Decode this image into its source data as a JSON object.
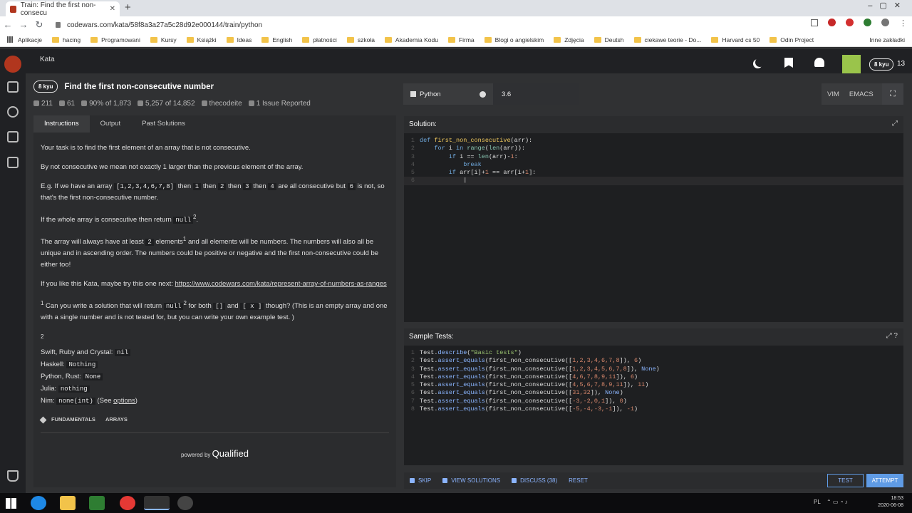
{
  "browser": {
    "tab_title": "Train: Find the first non-consecu",
    "url": "codewars.com/kata/58f8a3a27a5c28d92e000144/train/python",
    "bookmarks": [
      "Aplikacje",
      "hacing",
      "Programowani",
      "Kursy",
      "Książki",
      "Ideas",
      "English",
      "płatności",
      "szkoła",
      "Akademia Kodu",
      "Firma",
      "Blogi o angielskim",
      "Zdjęcia",
      "Deutsh",
      "ciekawe teorie - Do...",
      "Harvard cs 50",
      "Odin Project"
    ],
    "other_bookmarks": "Inne zakładki"
  },
  "header": {
    "kata_label": "Kata",
    "rank": "8 kyu",
    "honor": "13"
  },
  "kata": {
    "rank": "8 kyu",
    "title": "Find the first non-consecutive number",
    "stars": "211",
    "votes": "61",
    "satisfaction": "90% of 1,873",
    "completed": "5,257 of 14,852",
    "author": "thecodeite",
    "issues": "1 Issue Reported"
  },
  "tabs": [
    "Instructions",
    "Output",
    "Past Solutions"
  ],
  "desc": {
    "p1": "Your task is to find the first element of an array that is not consecutive.",
    "p2": "By not consecutive we mean not exactly 1 larger than the previous element of the array.",
    "p3a": "E.g. If we have an array ",
    "p3code1": "[1,2,3,4,6,7,8]",
    "p3b": " then ",
    "p3code2": "1",
    "p3c": " then ",
    "p3code3": "2",
    "p3d": " then ",
    "p3code4": "3",
    "p3e": " then ",
    "p3code5": "4",
    "p3f": " are all consecutive but ",
    "p3code6": "6",
    "p3g": " is not, so that's the first non-consecutive number.",
    "p4a": "If the whole array is consecutive then return ",
    "p4code": "null",
    "p4sup": "2",
    "p4b": ".",
    "p5a": "The array will always have at least ",
    "p5code": "2",
    "p5b": " elements",
    "p5sup": "1",
    "p5c": " and all elements will be numbers. The numbers will also all be unique and in ascending order. The numbers could be positive or negative and the first non-consecutive could be either too!",
    "p6a": "If you like this Kata, maybe try this one next: ",
    "p6link": "https://www.codewars.com/kata/represent-array-of-numbers-as-ranges",
    "p7sup": "1",
    "p7a": " Can you write a solution that will return ",
    "p7code1": "null",
    "p7sup2": "2",
    "p7b": " for both ",
    "p7code2": "[]",
    "p7c": " and ",
    "p7code3": "[ x ]",
    "p7d": " though? (This is an empty array and one with a single number and is not tested for, but you can write your own example test. )",
    "fn2": "2",
    "l1a": "Swift, Ruby and Crystal: ",
    "l1c": "nil",
    "l2a": "Haskell: ",
    "l2c": "Nothing",
    "l3a": "Python, Rust: ",
    "l3c": "None",
    "l4a": "Julia: ",
    "l4c": "nothing",
    "l5a": "Nim: ",
    "l5c": "none(int)",
    "l5b": " (See ",
    "l5link": "options",
    "l5d": ")"
  },
  "tags": [
    "FUNDAMENTALS",
    "ARRAYS"
  ],
  "powered": {
    "prefix": "powered by",
    "brand": "Qualified"
  },
  "editor": {
    "language": "Python",
    "version": "3.6",
    "modes": [
      "VIM",
      "EMACS"
    ],
    "solution_label": "Solution:",
    "tests_label": "Sample Tests:"
  },
  "solution_lines": [
    "1",
    "2",
    "3",
    "4",
    "5",
    "6"
  ],
  "test_lines": [
    "1",
    "2",
    "3",
    "4",
    "5",
    "6",
    "7",
    "8"
  ],
  "actions": {
    "skip": "SKIP",
    "view": "VIEW SOLUTIONS",
    "discuss": "DISCUSS (38)",
    "reset": "RESET",
    "test": "TEST",
    "attempt": "ATTEMPT"
  },
  "tray": {
    "lang": "PL",
    "time": "18:53",
    "date": "2020-06-08"
  }
}
